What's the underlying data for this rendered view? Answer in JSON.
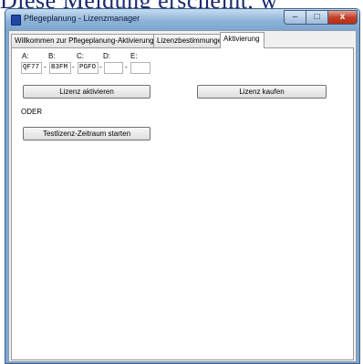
{
  "background_text": "Diese Meldung erscheint, w",
  "window": {
    "title": "Pflegeplanung - Lizenzmanager",
    "controls": {
      "minimize": "–",
      "maximize": "□",
      "close": "x"
    }
  },
  "tabs": [
    {
      "label": "Willkommen zur Pflegeplanung-Aktivierung",
      "active": false
    },
    {
      "label": "Lizenzbestimmungen",
      "active": false
    },
    {
      "label": "Aktivierung",
      "active": true
    }
  ],
  "activation": {
    "field_labels": [
      "A:",
      "B:",
      "C:",
      "D:",
      "E:"
    ],
    "fields": [
      "QF77",
      "B3FM",
      "PGFO",
      "",
      ""
    ],
    "separator": "-",
    "activate_button": "Lizenz aktivieren",
    "buy_button": "Lizenz kaufen",
    "or_text": "ODER",
    "trial_button": "Testlizenz-Zeitraum starten"
  }
}
